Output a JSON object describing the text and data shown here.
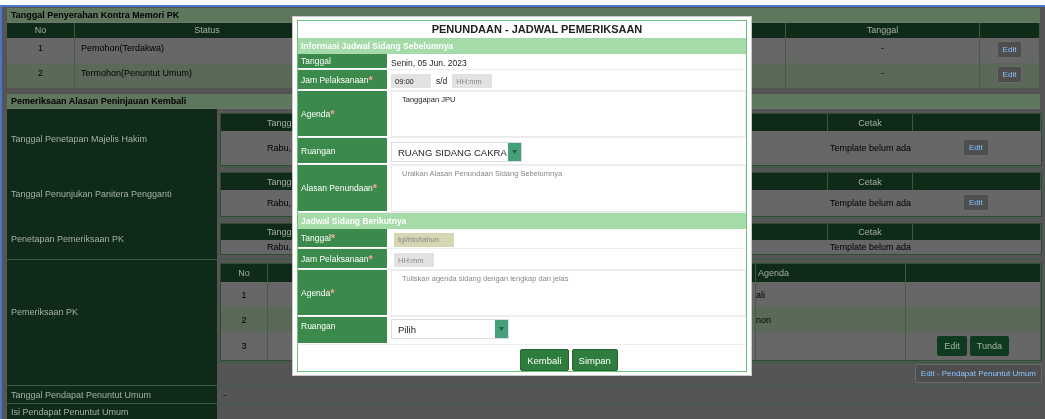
{
  "background": {
    "section_1": {
      "title": "Tanggal Penyerahan Kontra Memori PK",
      "columns": [
        "No",
        "Status",
        "Tanggal"
      ],
      "rows": [
        {
          "no": "1",
          "status": "Pemohon(Terdakwa)",
          "tanggal": "-",
          "action": "Edit"
        },
        {
          "no": "2",
          "status": "Termohon(Penuntut Umum)",
          "tanggal": "-",
          "action": "Edit"
        }
      ]
    },
    "section_2": {
      "title": "Pemeriksaan Alasan Peninjauan Kembali",
      "rows": [
        {
          "kind": "schedule",
          "label": "Tanggal Penetapan Majelis Hakim",
          "columns": [
            "Tangg",
            "Cetak"
          ],
          "date": "Rabu,",
          "template": "Template belum ada",
          "action": "Edit"
        },
        {
          "kind": "schedule",
          "label": "Tanggal Penunjukan Panitera Pengganti",
          "columns": [
            "Tangg",
            "Cetak"
          ],
          "date": "Rabu,",
          "template": "Template belum ada",
          "action": "Edit"
        },
        {
          "kind": "schedule",
          "label": "Penetapan Pemeriksaan PK",
          "columns": [
            "Tangg",
            "Cetak"
          ],
          "date": "Rabu,",
          "template": "Template belum ada"
        },
        {
          "kind": "hearings",
          "label": "Pemeriksaan PK",
          "columns": [
            "No",
            "Agenda"
          ],
          "rows": [
            {
              "no": "1",
              "agenda": "ali"
            },
            {
              "no": "2",
              "agenda": "non"
            },
            {
              "no": "3",
              "actions": [
                "Edit",
                "Tunda"
              ]
            }
          ]
        },
        {
          "kind": "action",
          "action": "Edit - Pendapat Penuntut Umum"
        },
        {
          "kind": "text",
          "label": "Tanggal Pendapat Penuntut Umum",
          "value": "-"
        },
        {
          "kind": "text",
          "label": "Isi Pendapat Penuntut Umum"
        }
      ]
    }
  },
  "modal": {
    "title": "PENUNDAAN - JADWAL PEMERIKSAAN",
    "sections": [
      {
        "title": "Informasi Jadwal Sidang Sebelumnya",
        "fields": [
          {
            "kind": "text",
            "label": "Tanggal",
            "value": "Senin, 05 Jun. 2023"
          },
          {
            "kind": "time_range",
            "label": "Jam Pelaksanaan",
            "required_mark": "*",
            "start": {
              "value": "09:00"
            },
            "separator": "s/d",
            "end": {
              "placeholder": "HH:mm"
            }
          },
          {
            "kind": "textarea",
            "label": "Agenda",
            "required_mark": "*",
            "value": "Tanggapan JPU"
          },
          {
            "kind": "select",
            "label": "Ruangan",
            "value": "RUANG SIDANG CAKRA"
          },
          {
            "kind": "textarea",
            "label": "Alasan Penundaan",
            "required_mark": "*",
            "placeholder": "Uraikan Alasan Penundaan Sidang Sebelumnya"
          }
        ]
      },
      {
        "title": "Jadwal Sidang Berikutnya",
        "fields": [
          {
            "kind": "date",
            "label": "Tanggal",
            "required_mark": "*",
            "placeholder": "tgl/bln/tahun"
          },
          {
            "kind": "time",
            "label": "Jam Pelaksanaan",
            "required_mark": "*",
            "placeholder": "HH:mm"
          },
          {
            "kind": "textarea",
            "label": "Agenda",
            "required_mark": "*",
            "placeholder": "Tuliskan agenda sidang dengan lengkap dan jelas"
          },
          {
            "kind": "select",
            "label": "Ruangan",
            "value": "Pilih"
          }
        ]
      }
    ],
    "buttons": [
      "Kembali",
      "Simpan"
    ]
  }
}
